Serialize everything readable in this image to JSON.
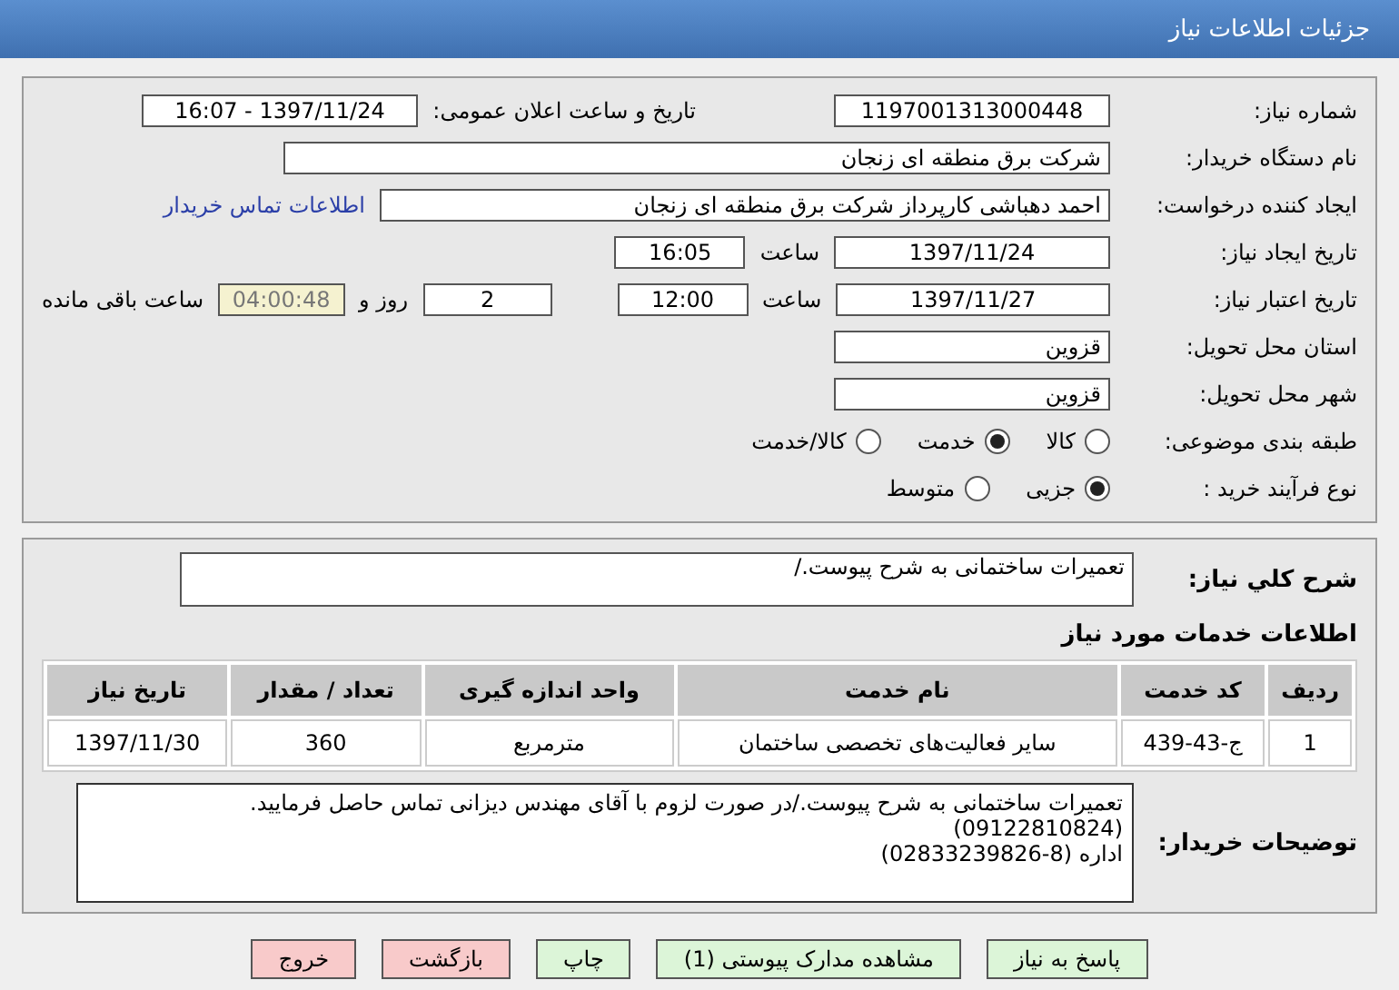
{
  "header": {
    "title": "جزئیات اطلاعات نیاز"
  },
  "need_number": {
    "label": "شماره نیاز:",
    "value": "1197001313000448"
  },
  "announce": {
    "label": "تاریخ و ساعت اعلان عمومی:",
    "value": "1397/11/24 - 16:07"
  },
  "buyer_org": {
    "label": "نام دستگاه خریدار:",
    "value": "شرکت برق منطقه ای زنجان"
  },
  "requester": {
    "label": "ایجاد کننده درخواست:",
    "value": "احمد دهباشی کارپرداز شرکت برق منطقه ای زنجان",
    "link": "اطلاعات تماس خریدار"
  },
  "created": {
    "label": "تاریخ ایجاد نیاز:",
    "date": "1397/11/24",
    "time_label": "ساعت",
    "time": "16:05"
  },
  "validity": {
    "label": "تاریخ اعتبار نیاز:",
    "date": "1397/11/27",
    "time_label": "ساعت",
    "time": "12:00",
    "days": "2",
    "days_label": "روز و",
    "remaining": "04:00:48",
    "remaining_label": "ساعت باقی مانده"
  },
  "province": {
    "label": "استان محل تحویل:",
    "value": "قزوین"
  },
  "city": {
    "label": "شهر محل تحویل:",
    "value": "قزوین"
  },
  "category": {
    "label": "طبقه بندی موضوعی:",
    "options": [
      {
        "label": "کالا",
        "selected": false
      },
      {
        "label": "خدمت",
        "selected": true
      },
      {
        "label": "کالا/خدمت",
        "selected": false
      }
    ]
  },
  "purchase_type": {
    "label": "نوع فرآیند خرید :",
    "options": [
      {
        "label": "جزیی",
        "selected": true
      },
      {
        "label": "متوسط",
        "selected": false
      }
    ]
  },
  "summary": {
    "label": "شرح کلي نیاز:",
    "value": "تعمیرات ساختمانی به شرح پیوست./"
  },
  "services": {
    "title": "اطلاعات خدمات مورد نیاز",
    "columns": [
      "ردیف",
      "کد خدمت",
      "نام خدمت",
      "واحد اندازه گیری",
      "تعداد / مقدار",
      "تاریخ نیاز"
    ],
    "rows": [
      [
        "1",
        "ج-43-439",
        "سایر فعالیت‌های تخصصی ساختمان",
        "مترمربع",
        "360",
        "1397/11/30"
      ]
    ]
  },
  "notes": {
    "label": "توضیحات خریدار:",
    "lines": [
      "تعمیرات ساختمانی به شرح پیوست./در صورت لزوم با آقای مهندس دیزانی تماس حاصل  فرمایید.",
      "(09122810824)",
      "اداره (8-02833239826)"
    ]
  },
  "buttons": [
    {
      "label": "پاسخ به نیاز",
      "kind": "go"
    },
    {
      "label": "مشاهده مدارک پیوستی (1)",
      "kind": "go"
    },
    {
      "label": "چاپ",
      "kind": "go"
    },
    {
      "label": "بازگشت",
      "kind": "stop"
    },
    {
      "label": "خروج",
      "kind": "stop"
    }
  ]
}
